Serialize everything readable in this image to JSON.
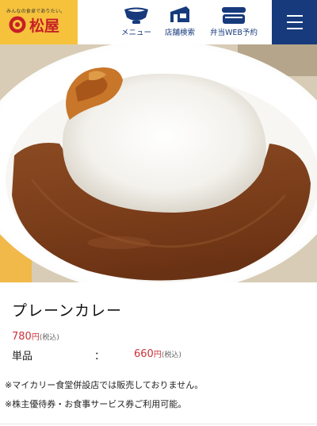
{
  "header": {
    "logo": {
      "tagline": "みんなの食卓でありたい。",
      "brand": "松屋"
    },
    "nav": [
      {
        "id": "menu",
        "label": "メニュー",
        "icon": "rice-bowl-icon"
      },
      {
        "id": "store",
        "label": "店舗検索",
        "icon": "store-icon"
      },
      {
        "id": "bento",
        "label": "弁当WEB予約",
        "icon": "bento-box-icon"
      }
    ],
    "hamburger_icon": "hamburger-menu-icon"
  },
  "product": {
    "name": "プレーンカレー",
    "price": "780",
    "price_unit": "円",
    "price_tax": "(税込)",
    "rows": [
      {
        "label": "単品",
        "separator": "：",
        "price": "660",
        "unit": "円",
        "tax": "(税込)"
      }
    ],
    "notes": [
      "※マイカリー食堂併設店では販売しておりません。",
      "※株主優待券・お食事サービス券ご利用可能。"
    ]
  },
  "colors": {
    "brand_yellow": "#f6c23c",
    "brand_red": "#c71f25",
    "navy": "#173a7c",
    "price_red": "#c9333a"
  }
}
